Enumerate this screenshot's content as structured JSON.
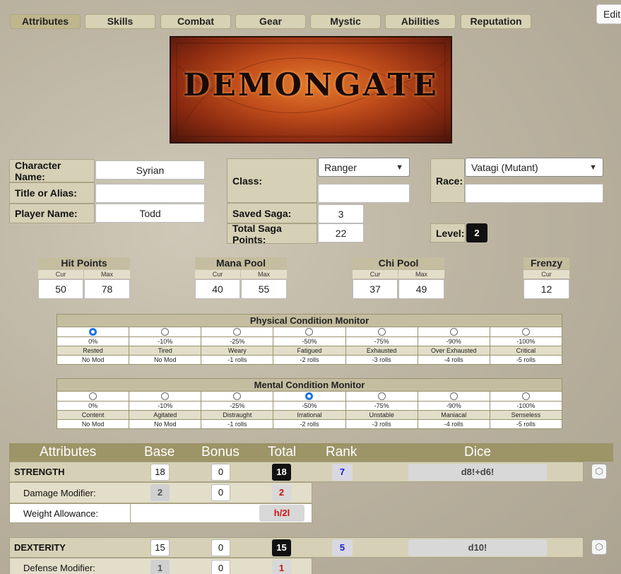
{
  "tabs": [
    "Attributes",
    "Skills",
    "Combat",
    "Gear",
    "Mystic",
    "Abilities",
    "Reputation"
  ],
  "edit_label": "Edit",
  "banner_text": "DEMONGATE",
  "character": {
    "name_label": "Character Name:",
    "name": "Syrian",
    "title_label": "Title or Alias:",
    "title": "",
    "player_label": "Player Name:",
    "player": "Todd",
    "class_label": "Class:",
    "class": "Ranger",
    "class_extra": "",
    "race_label": "Race:",
    "race": "Vatagi (Mutant)",
    "race_extra": "",
    "saved_saga_label": "Saved Saga:",
    "saved_saga": "3",
    "total_saga_label": "Total Saga Points:",
    "total_saga": "22",
    "level_label": "Level:",
    "level": "2"
  },
  "pools": {
    "cur": "Cur",
    "max": "Max",
    "hp": {
      "title": "Hit Points",
      "cur": "50",
      "max": "78"
    },
    "mana": {
      "title": "Mana Pool",
      "cur": "40",
      "max": "55"
    },
    "chi": {
      "title": "Chi Pool",
      "cur": "37",
      "max": "49"
    },
    "frenzy": {
      "title": "Frenzy",
      "cur": "12"
    }
  },
  "physical": {
    "title": "Physical Condition Monitor",
    "selected": 0,
    "pcts": [
      "0%",
      "-10%",
      "-25%",
      "-50%",
      "-75%",
      "-90%",
      "-100%"
    ],
    "names": [
      "Rested",
      "Tired",
      "Weary",
      "Fatigued",
      "Exhausted",
      "Over Exhausted",
      "Critical"
    ],
    "mods": [
      "No Mod",
      "No Mod",
      "-1 rolls",
      "-2 rolls",
      "-3 rolls",
      "-4 rolls",
      "-5 rolls"
    ]
  },
  "mental": {
    "title": "Mental Condition Monitor",
    "selected": 3,
    "pcts": [
      "0%",
      "-10%",
      "-25%",
      "-50%",
      "-75%",
      "-90%",
      "-100%"
    ],
    "names": [
      "Content",
      "Agitated",
      "Distraught",
      "Irrational",
      "Unstable",
      "Maniacal",
      "Senseless"
    ],
    "mods": [
      "No Mod",
      "No Mod",
      "-1 rolls",
      "-2 rolls",
      "-3 rolls",
      "-4 rolls",
      "-5 rolls"
    ]
  },
  "attr_header": {
    "attributes": "Attributes",
    "base": "Base",
    "bonus": "Bonus",
    "total": "Total",
    "rank": "Rank",
    "dice": "Dice"
  },
  "strength": {
    "name": "STRENGTH",
    "base": "18",
    "bonus": "0",
    "total": "18",
    "rank": "7",
    "dice": "d8!+d6!",
    "dmg_label": "Damage Modifier:",
    "dmg_base": "2",
    "dmg_bonus": "0",
    "dmg_total": "2",
    "wa_label": "Weight Allowance:",
    "wa_total": "h/2l"
  },
  "dexterity": {
    "name": "DEXTERITY",
    "base": "15",
    "bonus": "0",
    "total": "15",
    "rank": "5",
    "dice": "d10!",
    "def_label": "Defense Modifier:",
    "def_base": "1",
    "def_bonus": "0",
    "def_total": "1"
  },
  "colors": {
    "tab_bg": "#d8d2b4",
    "header_bg": "#9d9467",
    "radio_on": "#1a73e8",
    "total_bg": "#111111",
    "rank_color": "#1a1ad0",
    "red": "#cc1111"
  }
}
